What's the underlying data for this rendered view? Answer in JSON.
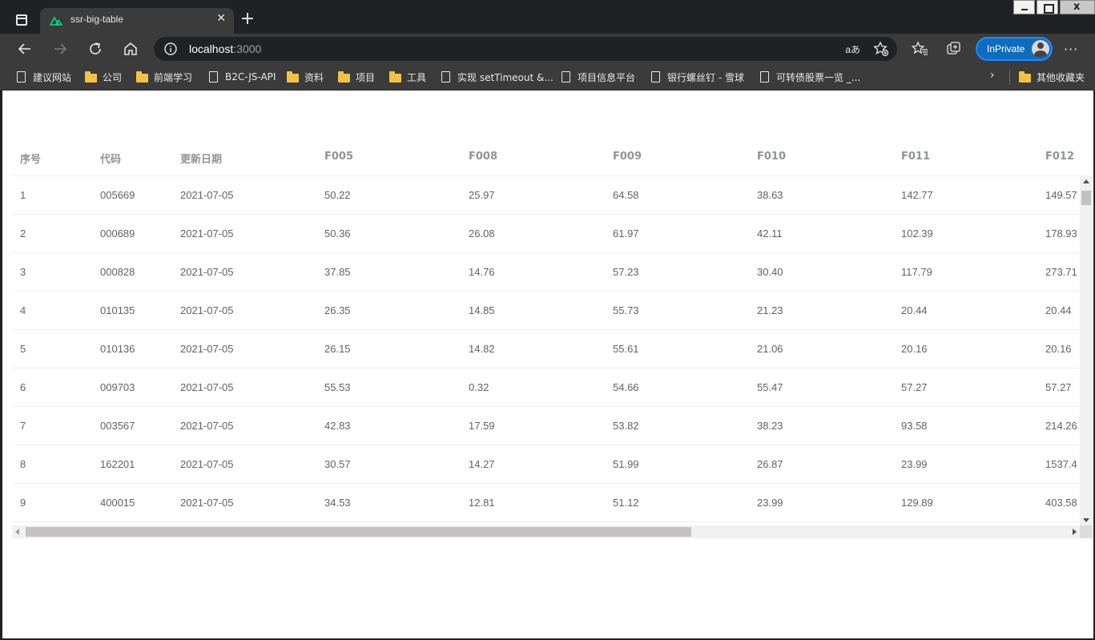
{
  "browser": {
    "tab_title": "ssr-big-table",
    "url_host": "localhost",
    "url_port": ":3000",
    "read_aloud": "aあ",
    "inprivate_label": "InPrivate",
    "accent_color": "#0f6cbd"
  },
  "bookmarks": [
    {
      "label": "建议网站",
      "icon": "page-icon"
    },
    {
      "label": "公司",
      "icon": "folder-icon"
    },
    {
      "label": "前端学习",
      "icon": "folder-icon"
    },
    {
      "label": "B2C-JS-API",
      "icon": "page-icon"
    },
    {
      "label": "资料",
      "icon": "folder-icon"
    },
    {
      "label": "项目",
      "icon": "folder-icon"
    },
    {
      "label": "工具",
      "icon": "folder-icon"
    },
    {
      "label": "实现 setTimeout &...",
      "icon": "page-icon"
    },
    {
      "label": "项目信息平台",
      "icon": "page-icon"
    },
    {
      "label": "银行螺丝钉 - 雪球",
      "icon": "page-icon"
    },
    {
      "label": "可转债股票一览 _...",
      "icon": "page-icon"
    }
  ],
  "other_bookmarks": "其他收藏夹",
  "table": {
    "columns": [
      "序号",
      "代码",
      "更新日期",
      "F005",
      "F008",
      "F009",
      "F010",
      "F011",
      "F012"
    ],
    "rows": [
      [
        "1",
        "005669",
        "2021-07-05",
        "50.22",
        "25.97",
        "64.58",
        "38.63",
        "142.77",
        "149.57"
      ],
      [
        "2",
        "000689",
        "2021-07-05",
        "50.36",
        "26.08",
        "61.97",
        "42.11",
        "102.39",
        "178.93"
      ],
      [
        "3",
        "000828",
        "2021-07-05",
        "37.85",
        "14.76",
        "57.23",
        "30.40",
        "117.79",
        "273.71"
      ],
      [
        "4",
        "010135",
        "2021-07-05",
        "26.35",
        "14.85",
        "55.73",
        "21.23",
        "20.44",
        "20.44"
      ],
      [
        "5",
        "010136",
        "2021-07-05",
        "26.15",
        "14.82",
        "55.61",
        "21.06",
        "20.16",
        "20.16"
      ],
      [
        "6",
        "009703",
        "2021-07-05",
        "55.53",
        "0.32",
        "54.66",
        "55.47",
        "57.27",
        "57.27"
      ],
      [
        "7",
        "003567",
        "2021-07-05",
        "42.83",
        "17.59",
        "53.82",
        "38.23",
        "93.58",
        "214.26"
      ],
      [
        "8",
        "162201",
        "2021-07-05",
        "30.57",
        "14.27",
        "51.99",
        "26.87",
        "23.99",
        "1537.4"
      ],
      [
        "9",
        "400015",
        "2021-07-05",
        "34.53",
        "12.81",
        "51.12",
        "23.99",
        "129.89",
        "403.58"
      ]
    ]
  }
}
